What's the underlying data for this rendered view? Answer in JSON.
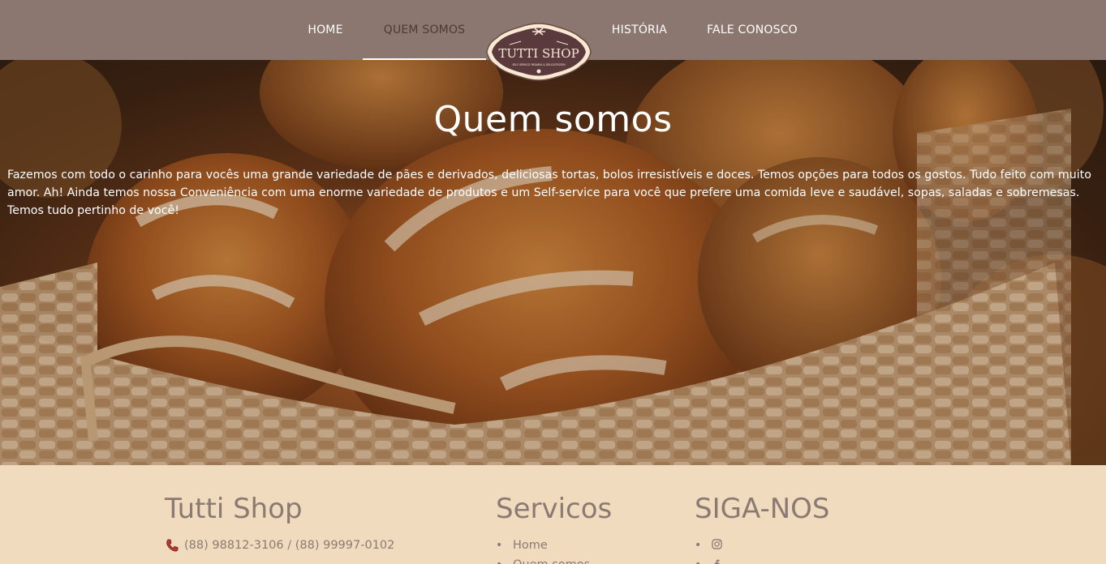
{
  "nav": {
    "items": [
      {
        "label": "HOME",
        "active": false
      },
      {
        "label": "QUEM SOMOS",
        "active": true
      },
      {
        "label": "HISTÓRIA",
        "active": false
      },
      {
        "label": "FALE CONOSCO",
        "active": false
      }
    ],
    "logo": {
      "name": "TUTTI SHOP",
      "tagline": "SELF-SERVICE PADARIA & DELICATESSEN"
    }
  },
  "hero": {
    "title": "Quem somos",
    "text": "Fazemos com todo o carinho para vocês uma grande variedade de pães e derivados, deliciosas tortas, bolos irresistíveis e doces. Temos opções para todos os gostos. Tudo feito com muito amor. Ah! Ainda temos nossa Conveniência com uma enorme variedade de produtos e um Self-service para você que prefere uma comida leve e saudável, sopas, saladas e sobremesas. Temos tudo pertinho de você!"
  },
  "footer": {
    "brand": {
      "title": "Tutti Shop",
      "phones": "(88) 98812-3106 / (88) 99997-0102"
    },
    "services": {
      "title": "Servicos",
      "items": [
        "Home",
        "Quem somos"
      ]
    },
    "social": {
      "title": "SIGA-NOS",
      "items": [
        "instagram-icon",
        "facebook-icon"
      ]
    }
  },
  "colors": {
    "navbar": "#8c7770",
    "footer_bg": "#f1dbbf",
    "footer_text": "#8b7a72",
    "active_nav_text": "#4a3b36"
  }
}
